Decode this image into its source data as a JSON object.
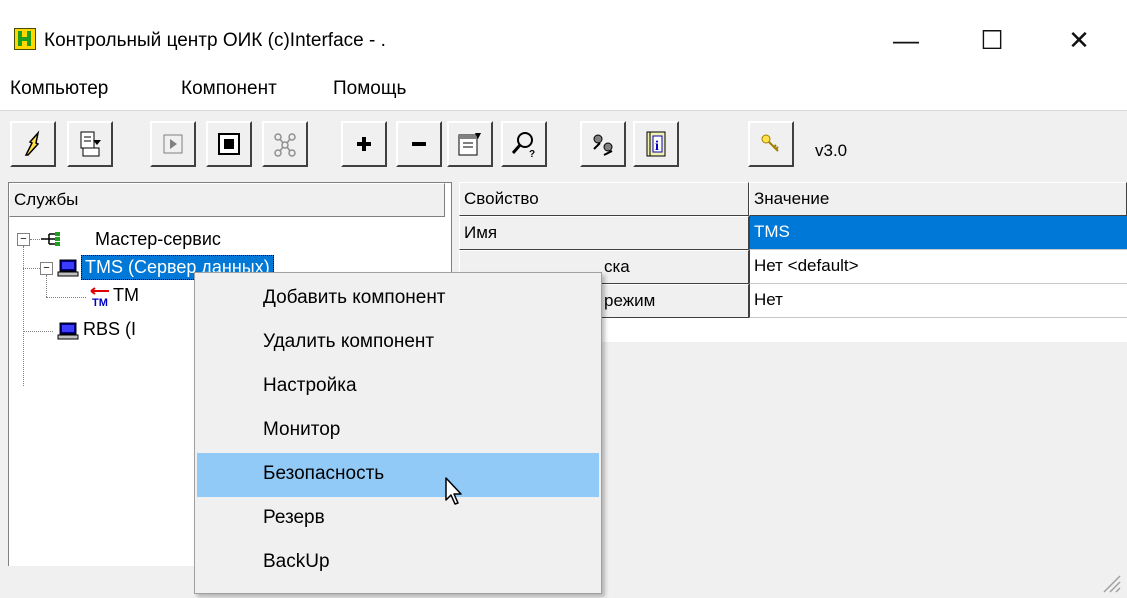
{
  "window": {
    "title": "Контрольный центр ОИК (c)Interface - .",
    "minimize_glyph": "—",
    "maximize_glyph": "☐",
    "close_glyph": "✕"
  },
  "menu": [
    "Компьютер",
    "Компонент",
    "Помощь"
  ],
  "toolbar": {
    "version": "v3.0",
    "buttons": [
      "connect-icon",
      "export-icon",
      "play-icon",
      "stop-icon",
      "network-icon",
      "plus-icon",
      "minus-icon",
      "properties-icon",
      "search-icon",
      "users-icon",
      "info-icon",
      "key-icon"
    ]
  },
  "tree": {
    "header": "Службы",
    "root": "Мастер-сервис",
    "node1": "TMS (Сервер данных)",
    "node1_child": "TM",
    "node2": "RBS (I"
  },
  "properties": {
    "col_property": "Свойство",
    "col_value": "Значение",
    "rows": [
      {
        "property": "Имя",
        "value": "TMS"
      },
      {
        "property": "ска",
        "value": "Нет <default>"
      },
      {
        "property": "режим",
        "value": "Нет"
      }
    ]
  },
  "context_menu": {
    "items": [
      "Добавить компонент",
      "Удалить компонент",
      "Настройка",
      "Монитор",
      "Безопасность",
      "Резерв",
      "BackUp"
    ],
    "highlighted": "Безопасность"
  },
  "colors": {
    "selection": "#0078d7",
    "menu_highlight": "#91c9f7"
  }
}
